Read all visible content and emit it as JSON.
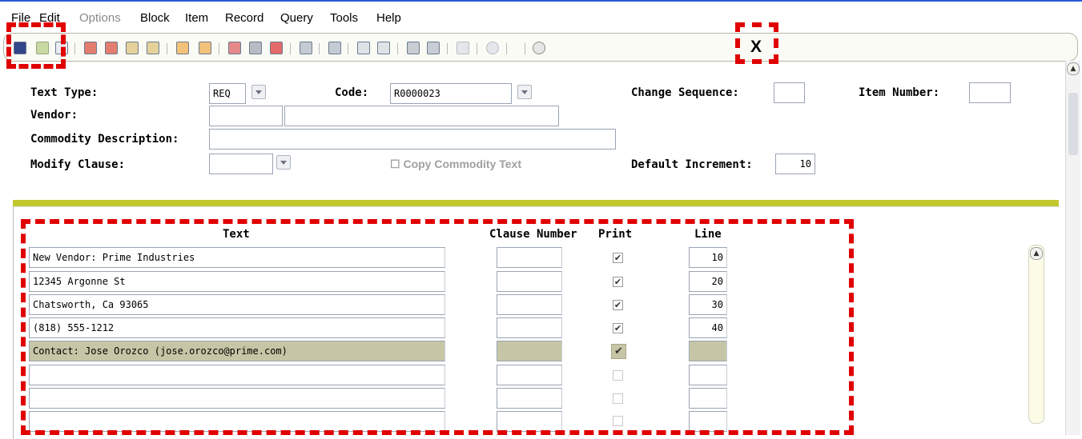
{
  "menu": [
    "File",
    "Edit",
    "Options",
    "Block",
    "Item",
    "Record",
    "Query",
    "Tools",
    "Help"
  ],
  "toolbar": {
    "icons": [
      "save-icon",
      "rollback-icon",
      "select-icon",
      "insert-record-icon",
      "remove-record-icon",
      "first-record-icon",
      "last-record-icon",
      "previous-block-icon",
      "next-block-icon",
      "enter-query-icon",
      "execute-query-icon",
      "cancel-query-icon",
      "print-icon",
      "export-icon",
      "excel-icon",
      "word-icon",
      "extract-icon",
      "exit-icon-large",
      "speaker-icon",
      "target-icon",
      "help-icon"
    ],
    "exit_label": "X"
  },
  "header": {
    "text_type_label": "Text Type:",
    "text_type_value": "REQ",
    "code_label": "Code:",
    "code_value": "R0000023",
    "change_seq_label": "Change Sequence:",
    "change_seq_value": "",
    "item_number_label": "Item Number:",
    "item_number_value": "",
    "vendor_label": "Vendor:",
    "vendor_id": "",
    "vendor_name": "",
    "commodity_label": "Commodity Description:",
    "commodity_value": "",
    "modify_clause_label": "Modify Clause:",
    "modify_clause_value": "",
    "copy_commodity_label": "Copy Commodity Text",
    "default_increment_label": "Default Increment:",
    "default_increment_value": "10"
  },
  "detail": {
    "columns": {
      "text": "Text",
      "clause": "Clause Number",
      "print": "Print",
      "line": "Line"
    },
    "rows": [
      {
        "text": "New Vendor: Prime Industries",
        "clause": "",
        "print": true,
        "line": "10"
      },
      {
        "text": "12345 Argonne St",
        "clause": "",
        "print": true,
        "line": "20"
      },
      {
        "text": "Chatsworth, Ca 93065",
        "clause": "",
        "print": true,
        "line": "30"
      },
      {
        "text": "(818) 555-1212",
        "clause": "",
        "print": true,
        "line": "40"
      },
      {
        "text": "Contact: Jose Orozco (jose.orozco@prime.com)",
        "clause": "",
        "print": true,
        "line": ""
      },
      {
        "text": "",
        "clause": "",
        "print": false,
        "line": ""
      },
      {
        "text": "",
        "clause": "",
        "print": false,
        "line": ""
      },
      {
        "text": "",
        "clause": "",
        "print": false,
        "line": ""
      }
    ]
  },
  "colors": {
    "accent_olive": "#c3c72e",
    "current_row": "#c6c6a6",
    "annotation_red": "#e00000"
  }
}
